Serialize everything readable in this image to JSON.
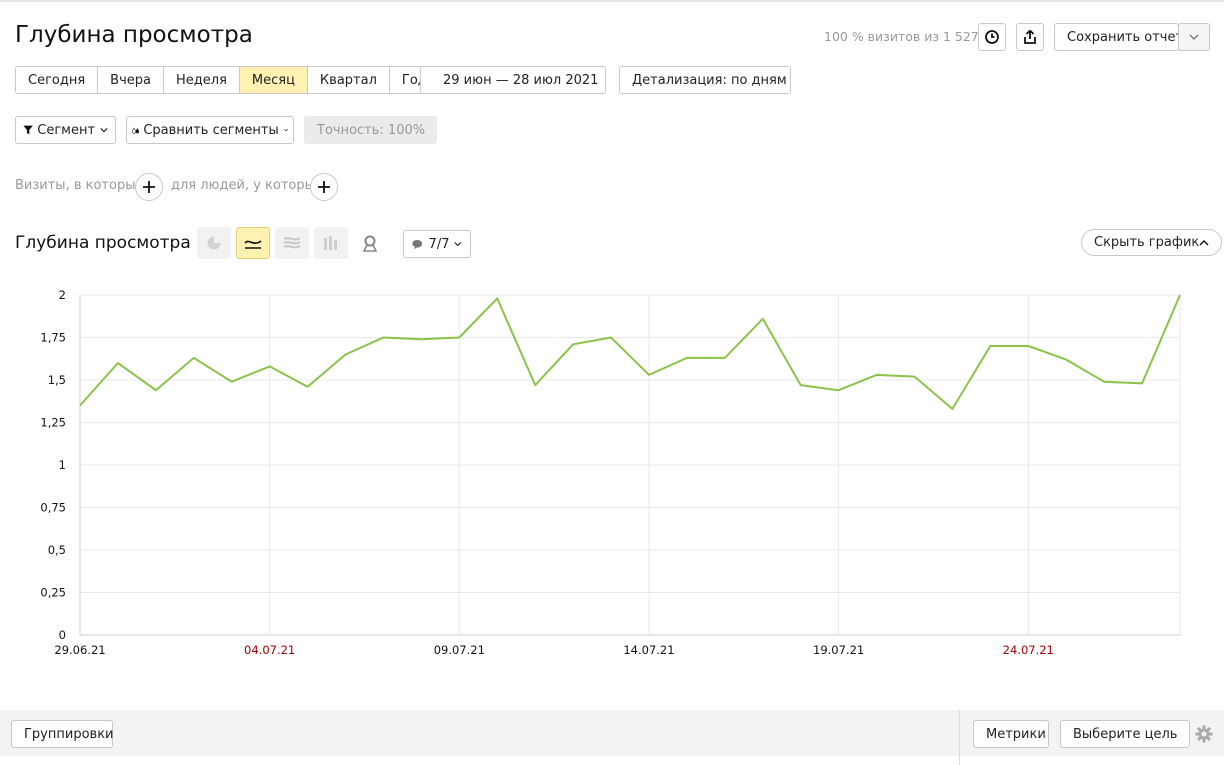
{
  "header": {
    "title": "Глубина просмотра",
    "visits_info": "100 % визитов из 1 527",
    "save_label": "Сохранить отчет"
  },
  "periods": [
    {
      "label": "Сегодня",
      "active": false
    },
    {
      "label": "Вчера",
      "active": false
    },
    {
      "label": "Неделя",
      "active": false
    },
    {
      "label": "Месяц",
      "active": true
    },
    {
      "label": "Квартал",
      "active": false
    },
    {
      "label": "Год",
      "active": false
    }
  ],
  "date_range": "29 июн — 28 июл 2021",
  "detail_label": "Детализация: по дням",
  "segment_label": "Сегмент",
  "compare_label": "Сравнить сегменты",
  "accuracy_label": "Точность: 100%",
  "filters": {
    "visits_label": "Визиты, в которых",
    "people_label": "для людей, у которых"
  },
  "chart_section": {
    "title": "Глубина просмотра",
    "series_count": "7/7",
    "hide_label": "Скрыть график"
  },
  "footer": {
    "groupings_label": "Группировки",
    "metrics_label": "Метрики",
    "goal_label": "Выберите цель"
  },
  "colors": {
    "line": "#8bc34a",
    "weekend_label": "#a30000",
    "active_bg": "#fff1b2"
  },
  "chart_data": {
    "type": "line",
    "x": [
      "29.06.21",
      "30.06.21",
      "01.07.21",
      "02.07.21",
      "03.07.21",
      "04.07.21",
      "05.07.21",
      "06.07.21",
      "07.07.21",
      "08.07.21",
      "09.07.21",
      "10.07.21",
      "11.07.21",
      "12.07.21",
      "13.07.21",
      "14.07.21",
      "15.07.21",
      "16.07.21",
      "17.07.21",
      "18.07.21",
      "19.07.21",
      "20.07.21",
      "21.07.21",
      "22.07.21",
      "23.07.21",
      "24.07.21",
      "25.07.21",
      "26.07.21",
      "27.07.21",
      "28.07.21"
    ],
    "series": [
      {
        "values": [
          1.35,
          1.6,
          1.44,
          1.63,
          1.49,
          1.58,
          1.46,
          1.65,
          1.75,
          1.74,
          1.75,
          1.98,
          1.47,
          1.71,
          1.75,
          1.53,
          1.63,
          1.63,
          1.86,
          1.47,
          1.44,
          1.53,
          1.52,
          1.33,
          1.7,
          1.7,
          1.62,
          1.49,
          1.48,
          2.0
        ]
      }
    ],
    "xticks": [
      {
        "label": "29.06.21",
        "index": 0,
        "weekend": false
      },
      {
        "label": "04.07.21",
        "index": 5,
        "weekend": true
      },
      {
        "label": "09.07.21",
        "index": 10,
        "weekend": false
      },
      {
        "label": "14.07.21",
        "index": 15,
        "weekend": false
      },
      {
        "label": "19.07.21",
        "index": 20,
        "weekend": false
      },
      {
        "label": "24.07.21",
        "index": 25,
        "weekend": true
      }
    ],
    "yticks": [
      {
        "label": "2",
        "value": 2
      },
      {
        "label": "1,75",
        "value": 1.75
      },
      {
        "label": "1,5",
        "value": 1.5
      },
      {
        "label": "1,25",
        "value": 1.25
      },
      {
        "label": "1",
        "value": 1
      },
      {
        "label": "0,75",
        "value": 0.75
      },
      {
        "label": "0,5",
        "value": 0.5
      },
      {
        "label": "0,25",
        "value": 0.25
      },
      {
        "label": "0",
        "value": 0
      }
    ],
    "ylim": [
      0,
      2
    ],
    "grid": true
  }
}
